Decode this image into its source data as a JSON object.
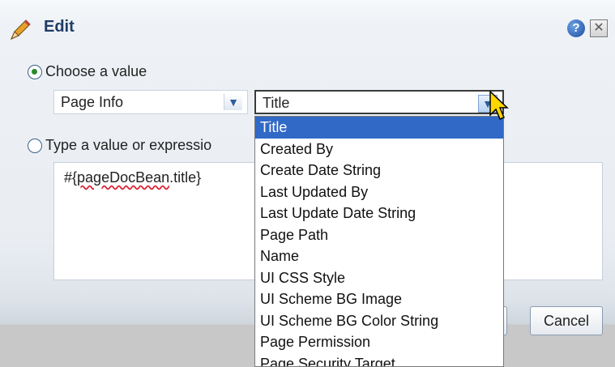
{
  "dialog": {
    "title": "Edit",
    "help_label": "?",
    "close_label": "✕"
  },
  "choose": {
    "radio_label": "Choose a value",
    "category_value": "Page Info",
    "property_value": "Title"
  },
  "type": {
    "radio_label": "Type a value or expressio",
    "expression_prefix": "#{",
    "expression_misspelled": "pageDocBean",
    "expression_suffix": ".title}"
  },
  "dropdown": {
    "items": [
      "Title",
      "Created By",
      "Create Date String",
      "Last Updated By",
      "Last Update Date String",
      "Page Path",
      "Name",
      "UI CSS Style",
      "UI Scheme BG Image",
      "UI Scheme BG Color String",
      "Page Permission",
      "Page Security Target"
    ],
    "selected_index": 0
  },
  "buttons": {
    "cancel_label": "Cancel"
  },
  "icons": {
    "title": "pencil-icon",
    "help": "help-icon",
    "close": "close-icon",
    "arrow": "chevron-down-icon",
    "cursor": "mouse-pointer-icon"
  },
  "colors": {
    "title_text": "#1f3c66",
    "selection": "#3169c6",
    "radio_dot": "#2a8a2a"
  }
}
